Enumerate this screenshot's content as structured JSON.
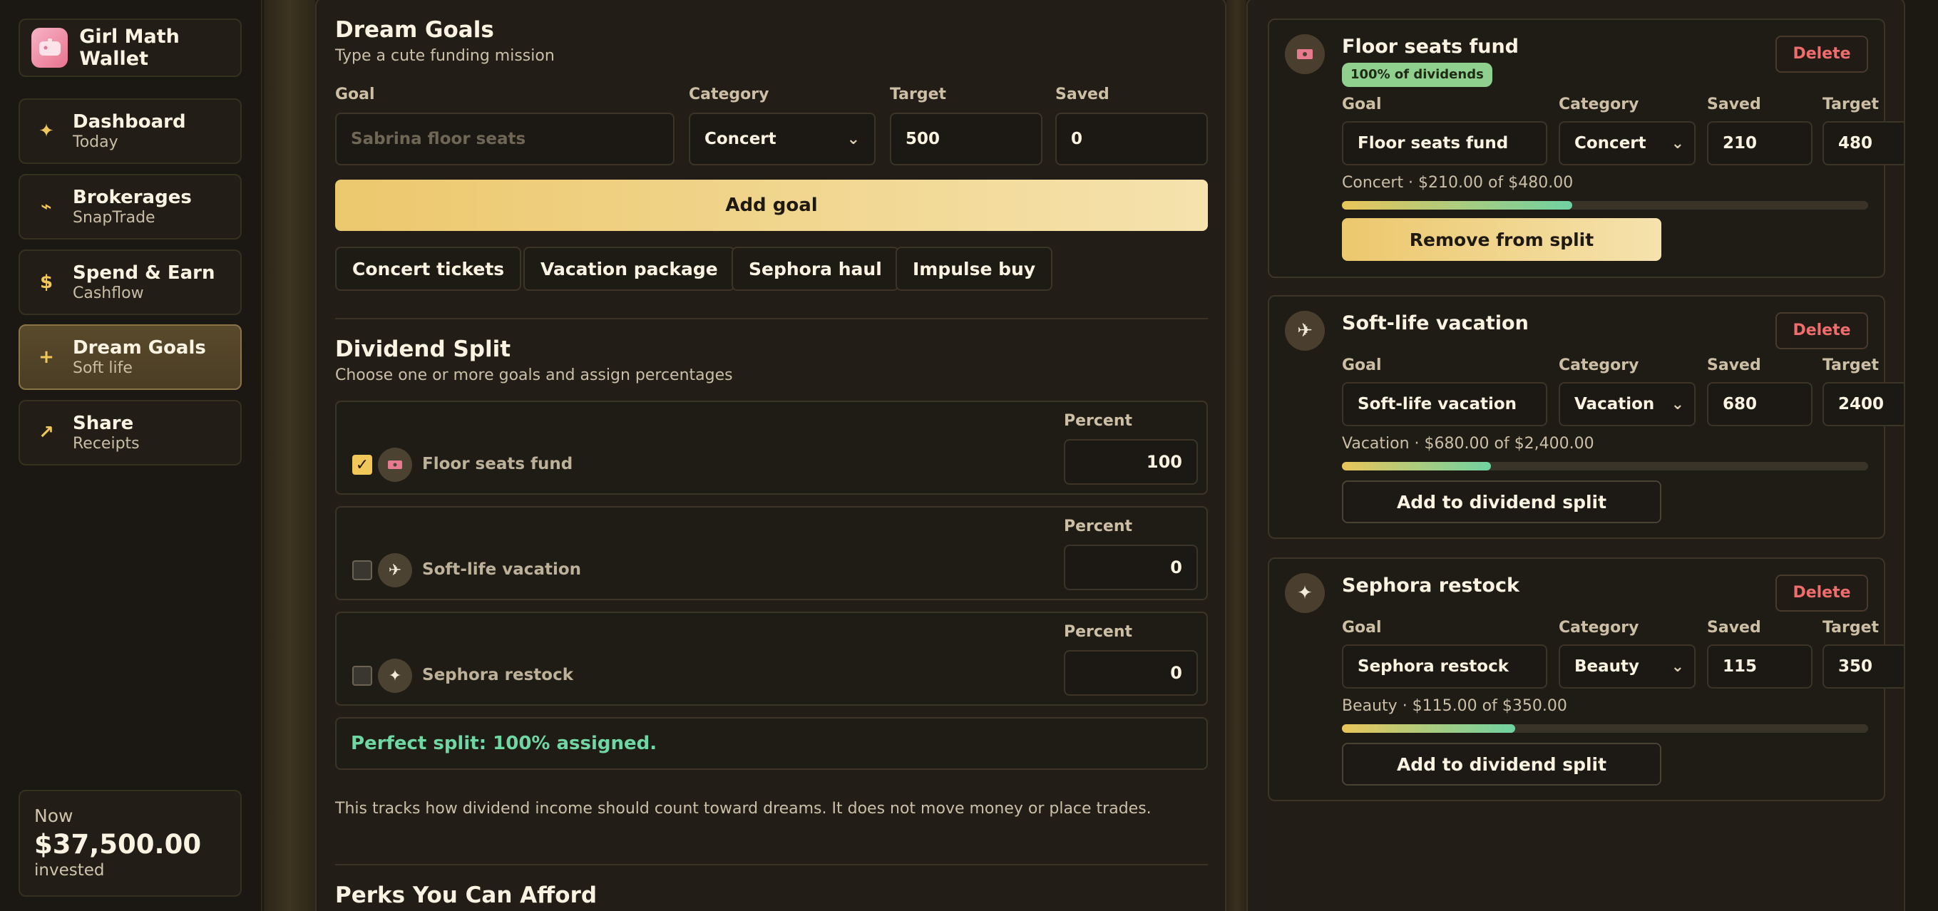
{
  "app": {
    "name": "Girl Math Wallet",
    "logo_icon": "piggy-bank-icon"
  },
  "sidebar": {
    "items": [
      {
        "title": "Dashboard",
        "sub": "Today",
        "icon": "✦",
        "active": false
      },
      {
        "title": "Brokerages",
        "sub": "SnapTrade",
        "icon": "⌁",
        "active": false
      },
      {
        "title": "Spend & Earn",
        "sub": "Cashflow",
        "icon": "$",
        "active": false
      },
      {
        "title": "Dream Goals",
        "sub": "Soft life",
        "icon": "+",
        "active": true
      },
      {
        "title": "Share",
        "sub": "Receipts",
        "icon": "↗",
        "active": false
      }
    ],
    "invested": {
      "now_label": "Now",
      "amount": "$37,500.00",
      "label": "invested"
    }
  },
  "dream_goals": {
    "title": "Dream Goals",
    "subtitle": "Type a cute funding mission",
    "form": {
      "goal_label": "Goal",
      "goal_placeholder": "Sabrina floor seats",
      "category_label": "Category",
      "category_value": "Concert",
      "target_label": "Target",
      "target_value": "500",
      "saved_label": "Saved",
      "saved_value": "0",
      "add_button": "Add goal"
    },
    "presets": [
      "Concert tickets",
      "Vacation package",
      "Sephora haul",
      "Impulse buy"
    ]
  },
  "dividend_split": {
    "title": "Dividend Split",
    "subtitle": "Choose one or more goals and assign percentages",
    "percent_label": "Percent",
    "rows": [
      {
        "name": "Floor seats fund",
        "checked": true,
        "percent": "100",
        "icon": "🎟"
      },
      {
        "name": "Soft-life vacation",
        "checked": false,
        "percent": "0",
        "icon": "✈"
      },
      {
        "name": "Sephora restock",
        "checked": false,
        "percent": "0",
        "icon": "✦"
      }
    ],
    "status": "Perfect split: 100% assigned.",
    "note": "This tracks how dividend income should count toward dreams. It does not move money or place trades."
  },
  "perks": {
    "title": "Perks You Can Afford"
  },
  "goal_cards": [
    {
      "title": "Floor seats fund",
      "badge": "100% of dividends",
      "icon": "🎟",
      "delete_label": "Delete",
      "goal_label": "Goal",
      "goal_value": "Floor seats fund",
      "category_label": "Category",
      "category_value": "Concert",
      "saved_label": "Saved",
      "saved_value": "210",
      "target_label": "Target",
      "target_value": "480",
      "meta": "Concert · $210.00 of $480.00",
      "progress": 0.4375,
      "action": "Remove from split",
      "in_split": true
    },
    {
      "title": "Soft-life vacation",
      "badge": "",
      "icon": "✈",
      "delete_label": "Delete",
      "goal_label": "Goal",
      "goal_value": "Soft-life vacation",
      "category_label": "Category",
      "category_value": "Vacation",
      "saved_label": "Saved",
      "saved_value": "680",
      "target_label": "Target",
      "target_value": "2400",
      "meta": "Vacation · $680.00 of $2,400.00",
      "progress": 0.2833,
      "action": "Add to dividend split",
      "in_split": false
    },
    {
      "title": "Sephora restock",
      "badge": "",
      "icon": "✦",
      "delete_label": "Delete",
      "goal_label": "Goal",
      "goal_value": "Sephora restock",
      "category_label": "Category",
      "category_value": "Beauty",
      "saved_label": "Saved",
      "saved_value": "115",
      "target_label": "Target",
      "target_value": "350",
      "meta": "Beauty · $115.00 of $350.00",
      "progress": 0.3286,
      "action": "Add to dividend split",
      "in_split": false
    }
  ],
  "colors": {
    "accent_gold": "#f1c75a",
    "success_green": "#6fd7a3",
    "danger_red": "#ef6d6d"
  }
}
